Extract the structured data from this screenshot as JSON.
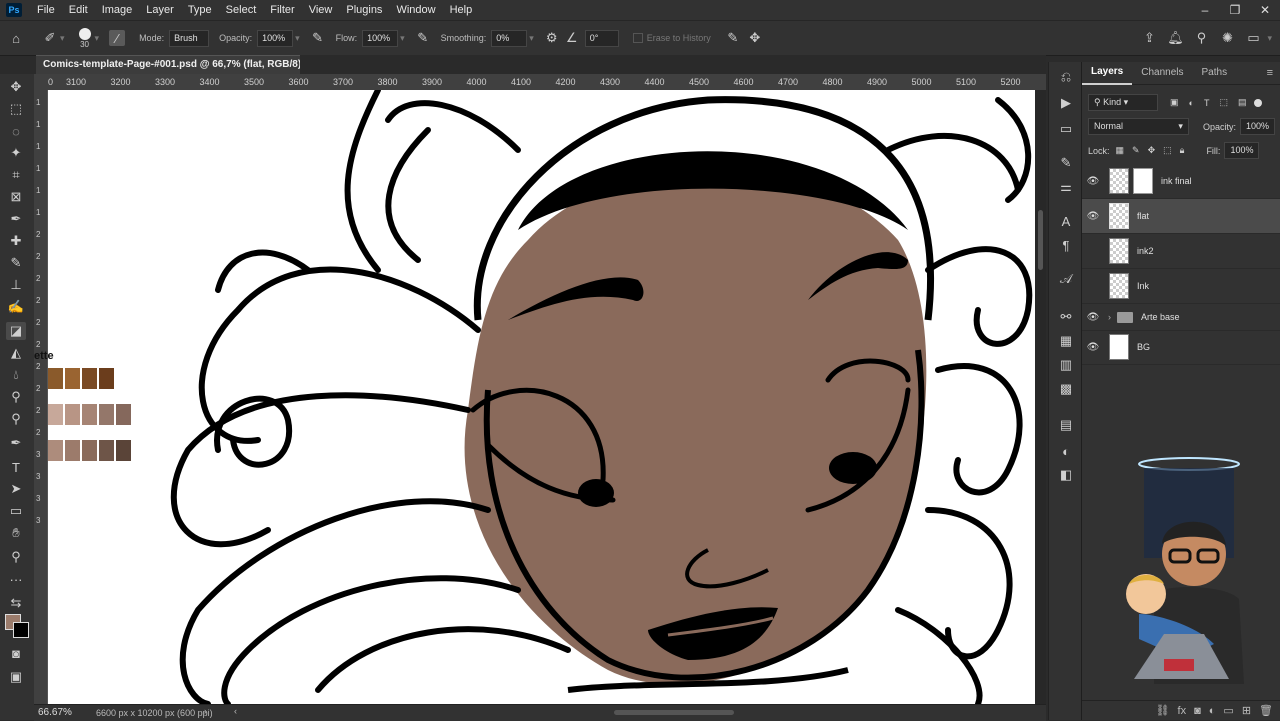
{
  "menubar": {
    "logo": "Ps",
    "items": [
      "File",
      "Edit",
      "Image",
      "Layer",
      "Type",
      "Select",
      "Filter",
      "View",
      "Plugins",
      "Window",
      "Help"
    ]
  },
  "options": {
    "brush_size": "30",
    "mode_label": "Mode:",
    "mode_value": "Brush",
    "opacity_label": "Opacity:",
    "opacity_value": "100%",
    "flow_label": "Flow:",
    "flow_value": "100%",
    "smoothing_label": "Smoothing:",
    "smoothing_value": "0%",
    "angle_value": "0°",
    "erase_history": "Erase to History"
  },
  "document": {
    "tab_title": "Comics-template-Page-#001.psd @ 66,7% (flat, RGB/8) *",
    "zoom": "66.67%",
    "doc_size": "6600 px x 10200 px (600 ppi)"
  },
  "ruler": {
    "top_labels": [
      "0",
      "3100",
      "3200",
      "3300",
      "3400",
      "3500",
      "3600",
      "3700",
      "3800",
      "3900",
      "4000",
      "4100",
      "4200",
      "4300",
      "4400",
      "4500",
      "4600",
      "4700",
      "4800",
      "4900",
      "5000",
      "5100",
      "5200"
    ],
    "left_labels": [
      "1",
      "1",
      "1",
      "1",
      "1",
      "1",
      "2",
      "2",
      "2",
      "2",
      "2",
      "2",
      "2",
      "2",
      "2",
      "2",
      "3",
      "3",
      "3",
      "3"
    ]
  },
  "palette": {
    "label": "ette",
    "rows": [
      [
        "#8a5a2b",
        "#9a6431",
        "#7a4a24",
        "#6b3d1c"
      ],
      [
        "#c7a89a",
        "#b89585",
        "#a68474",
        "#94776a",
        "#85685c"
      ],
      [
        "#ad8c7c",
        "#9c7b6b",
        "#8a6b5b",
        "#6e5548",
        "#5a4438"
      ]
    ]
  },
  "panel": {
    "tabs": [
      "Layers",
      "Channels",
      "Paths"
    ],
    "filter_kind": "Kind",
    "blend_mode": "Normal",
    "opacity_label": "Opacity:",
    "opacity_value": "100%",
    "lock_label": "Lock:",
    "fill_label": "Fill:",
    "fill_value": "100%",
    "layers": [
      {
        "name": "ink final",
        "visible": true,
        "selected": false
      },
      {
        "name": "flat",
        "visible": true,
        "selected": true
      },
      {
        "name": "ink2",
        "visible": false,
        "selected": false
      },
      {
        "name": "Ink",
        "visible": false,
        "selected": false
      },
      {
        "name": "Arte base",
        "visible": true,
        "group": true
      },
      {
        "name": "BG",
        "visible": true,
        "selected": false
      }
    ]
  },
  "colors": {
    "skin": "#8a6a5b",
    "foreground": "#9b7c6c",
    "accent_blue": "#31a8ff"
  }
}
